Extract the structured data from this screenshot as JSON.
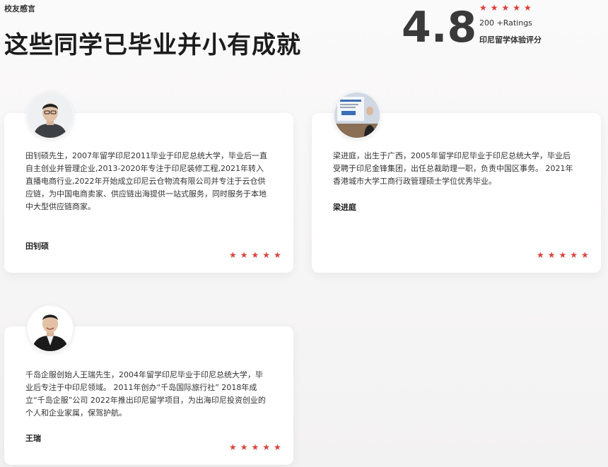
{
  "section": {
    "eyebrow": "校友感言",
    "title": "这些同学已毕业并小有成就"
  },
  "rating": {
    "score": "4.8",
    "stars": "★★★★★",
    "count": "200 +Ratings",
    "caption": "印尼留学体验评分"
  },
  "testimonials": [
    {
      "name": "田钊硕",
      "bio": "田钊硕先生，2007年留学印尼2011毕业于印尼总统大学，毕业后一直自主创业并管理企业,2013-2020年专注于印尼装修工程,2021年转入直播电商行业,2022年开始成立印尼云仓物流有限公司并专注于云仓供应链，为中国电商卖家、供应链出海提供一站式服务，同时服务于本地中大型供应链商家。",
      "stars": "★★★★★",
      "rating": 5
    },
    {
      "name": "梁进庭",
      "bio": "梁进庭，出生于广西，2005年留学印尼毕业于印尼总统大学，毕业后受聘于印尼金锋集团，出任总裁助理一职，负责中国区事务。 2021年香港城市大学工商行政管理硕士学位优秀毕业。",
      "stars": "★★★★★",
      "rating": 5
    },
    {
      "name": "王瑞",
      "bio": "千岛企服创始人王瑞先生，2004年留学印尼毕业于印尼总统大学，毕业后专注于中印尼领域。 2011年创办“千岛国际旅行社” 2018年成立“千岛企服”公司 2022年推出印尼留学项目，为出海印尼投资创业的个人和企业家属，保驾护航。",
      "stars": "★★★★★",
      "rating": 5
    }
  ],
  "colors": {
    "accent": "#d9443c",
    "headline": "#1c1c1c",
    "score": "#3a3a3a"
  },
  "icons": {
    "star": "star-icon",
    "avatar": "avatar-photo"
  }
}
